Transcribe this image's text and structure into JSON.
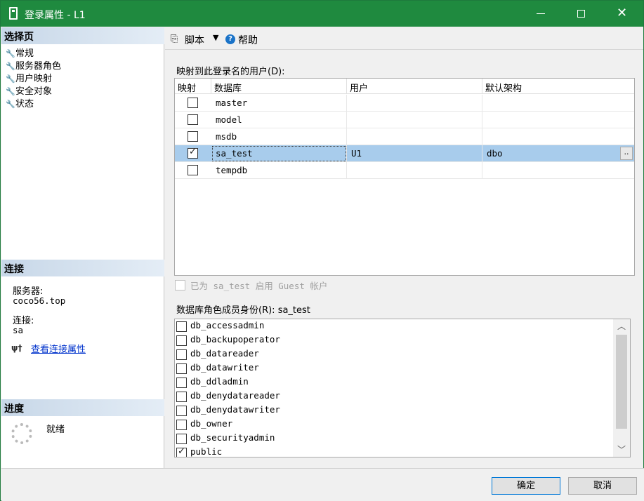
{
  "window": {
    "title": "登录属性 - L1",
    "minimize": "—",
    "maximize": "",
    "close": "✕"
  },
  "left": {
    "select_page": "选择页",
    "nav": [
      "常规",
      "服务器角色",
      "用户映射",
      "安全对象",
      "状态"
    ],
    "connection_header": "连接",
    "server_label": "服务器:",
    "server_value": "coco56.top",
    "connection_label": "连接:",
    "connection_value": "sa",
    "view_props_link": "查看连接属性",
    "progress_header": "进度",
    "progress_status": "就绪"
  },
  "toolbar": {
    "script": "脚本",
    "help": "帮助"
  },
  "mapping": {
    "label": "映射到此登录名的用户(D):",
    "columns": [
      "映射",
      "数据库",
      "用户",
      "默认架构"
    ],
    "rows": [
      {
        "mapped": false,
        "database": "master",
        "user": "",
        "schema": ""
      },
      {
        "mapped": false,
        "database": "model",
        "user": "",
        "schema": ""
      },
      {
        "mapped": false,
        "database": "msdb",
        "user": "",
        "schema": ""
      },
      {
        "mapped": true,
        "database": "sa_test",
        "user": "U1",
        "schema": "dbo",
        "selected": true
      },
      {
        "mapped": false,
        "database": "tempdb",
        "user": "",
        "schema": ""
      }
    ],
    "ellipsis": ".."
  },
  "guest": {
    "label": "已为 sa_test 启用 Guest 帐户",
    "checked": false,
    "disabled": true
  },
  "roles": {
    "label": "数据库角色成员身份(R): sa_test",
    "items": [
      {
        "name": "db_accessadmin",
        "checked": false
      },
      {
        "name": "db_backupoperator",
        "checked": false
      },
      {
        "name": "db_datareader",
        "checked": false
      },
      {
        "name": "db_datawriter",
        "checked": false
      },
      {
        "name": "db_ddladmin",
        "checked": false
      },
      {
        "name": "db_denydatareader",
        "checked": false
      },
      {
        "name": "db_denydatawriter",
        "checked": false
      },
      {
        "name": "db_owner",
        "checked": false
      },
      {
        "name": "db_securityadmin",
        "checked": false
      },
      {
        "name": "public",
        "checked": true
      }
    ]
  },
  "buttons": {
    "ok": "确定",
    "cancel": "取消"
  }
}
